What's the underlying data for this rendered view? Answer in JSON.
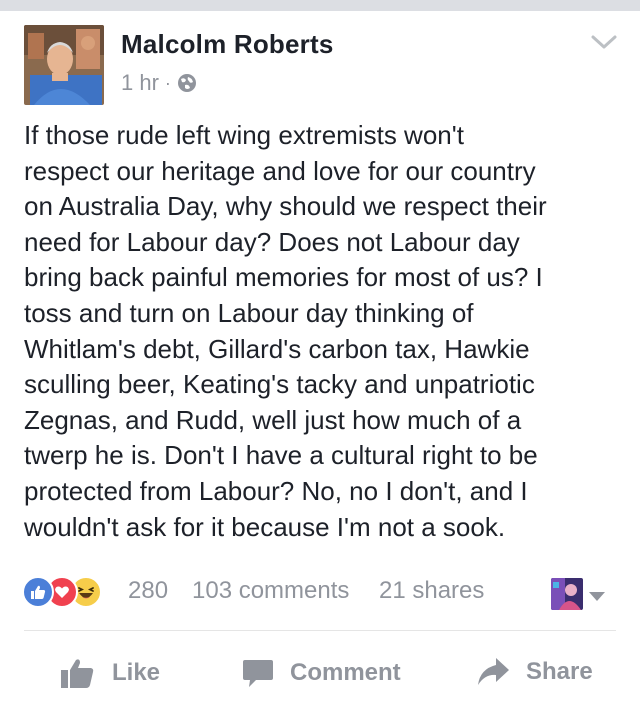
{
  "post": {
    "author": "Malcolm Roberts",
    "time": "1 hr",
    "separator": "·",
    "body": "If those rude left wing extremists won't\nrespect our heritage and love for our country\non Australia Day, why should we respect their\nneed for Labour day? Does not Labour day\nbring back painful memories for most of us? I\ntoss and turn on Labour day thinking of\nWhitlam's debt, Gillard's carbon tax, Hawkie\nsculling beer, Keating's tacky and unpatriotic\nZegnas, and Rudd, well just how much of a\ntwerp he is. Don't I have a cultural right to be\nprotected from Labour? No, no I don't, and I\nwouldn't ask for it because I'm not a sook."
  },
  "stats": {
    "reactions": "280",
    "comments": "103 comments",
    "shares": "21 shares"
  },
  "actions": {
    "like": "Like",
    "comment": "Comment",
    "share": "Share"
  },
  "colors": {
    "text": "#1d2129",
    "muted": "#90949c",
    "like_blue": "#4b7fd8",
    "love_red": "#f0414f",
    "haha_yellow": "#f6cd4a"
  },
  "icons": {
    "audience": "globe-icon",
    "menu": "chevron-down-icon",
    "reaction_like": "thumbs-up-reaction-icon",
    "reaction_love": "heart-reaction-icon",
    "reaction_haha": "laughing-reaction-icon",
    "like": "thumbs-up-icon",
    "comment": "comment-bubble-icon",
    "share": "share-arrow-icon"
  }
}
